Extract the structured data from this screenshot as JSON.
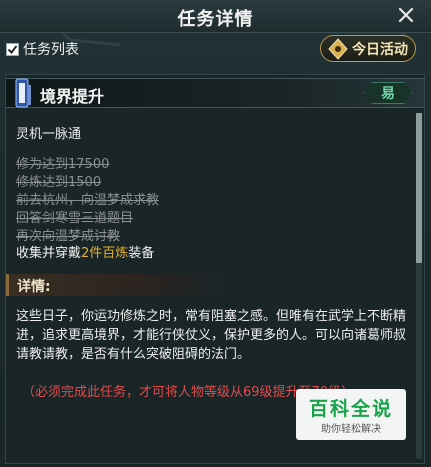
{
  "window": {
    "title": "任务详情"
  },
  "filter": {
    "checkbox_label": "任务列表",
    "checked": true
  },
  "daily_button": {
    "label": "今日活动"
  },
  "task": {
    "title": "境界提升",
    "difficulty": "易",
    "subtitle": "灵机一脉通",
    "completed_steps": [
      "修为达到17500",
      "修炼达到1500",
      "前去杭州，向温梦成求教",
      "回答剑寒雪三道题目",
      "再次向温梦成讨教"
    ],
    "current_step": {
      "prefix": "收集并穿戴",
      "highlight": "2件百炼",
      "suffix": "装备"
    }
  },
  "details": {
    "heading": "详情:",
    "description": "这些日子，你运功修炼之时，常有阻塞之感。但唯有在武学上不断精进，追求更高境界，才能行侠仗义，保护更多的人。可以向诸葛师叔请教请教，是否有什么突破阻碍的法门。",
    "note": "（必须完成此任务，才可将人物等级从69级提升至70级）"
  },
  "watermark": {
    "main": "百科全说",
    "sub": "助你轻松解决"
  },
  "colors": {
    "highlight": "#e0b237",
    "note": "#e14b4b",
    "difficulty": "#6fd6a9"
  }
}
